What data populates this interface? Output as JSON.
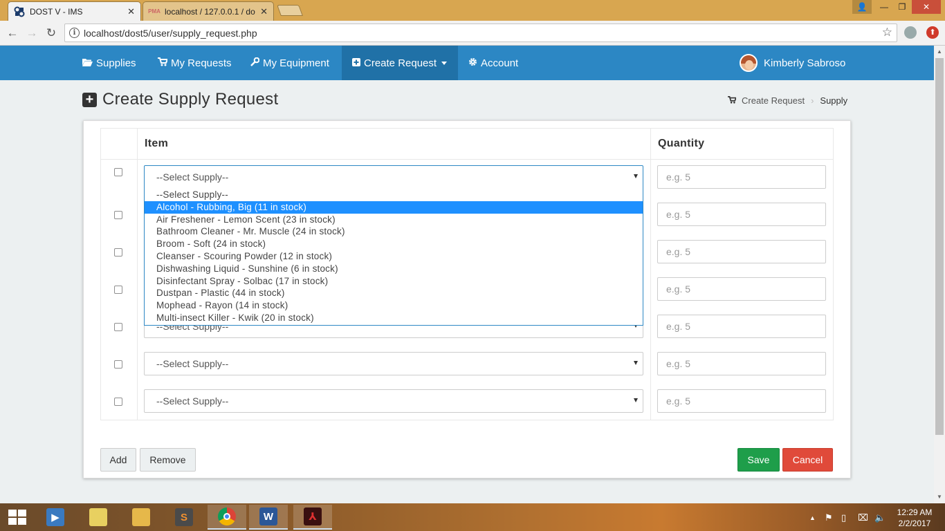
{
  "browser": {
    "tabs": [
      {
        "title": "DOST V - IMS",
        "active": true
      },
      {
        "title": "localhost / 127.0.0.1 / do",
        "active": false
      }
    ],
    "url": "localhost/dost5/user/supply_request.php"
  },
  "nav": {
    "items": [
      {
        "label": "Supplies",
        "icon": "folder-open-icon"
      },
      {
        "label": "My Requests",
        "icon": "cart-icon"
      },
      {
        "label": "My Equipment",
        "icon": "wrench-icon"
      },
      {
        "label": "Create Request",
        "icon": "plus-square-icon",
        "active": true,
        "dropdown": true
      },
      {
        "label": "Account",
        "icon": "gear-icon"
      }
    ],
    "user_name": "Kimberly Sabroso"
  },
  "page": {
    "title": "Create Supply Request",
    "breadcrumb": [
      "Create Request",
      "Supply"
    ]
  },
  "table": {
    "headers": {
      "item": "Item",
      "quantity": "Quantity"
    },
    "select_placeholder": "--Select Supply--",
    "qty_placeholder": "e.g. 5",
    "rows": 7,
    "dropdown_options": [
      "--Select Supply--",
      "Alcohol - Rubbing, Big (11 in stock)",
      "Air Freshener - Lemon Scent (23 in stock)",
      "Bathroom Cleaner - Mr. Muscle (24 in stock)",
      "Broom - Soft (24 in stock)",
      "Cleanser - Scouring Powder (12 in stock)",
      "Dishwashing Liquid - Sunshine (6 in stock)",
      "Disinfectant Spray - Solbac (17 in stock)",
      "Dustpan - Plastic (44 in stock)",
      "Mophead - Rayon (14 in stock)",
      "Multi-insect Killer - Kwik (20 in stock)"
    ],
    "highlighted_option": "Alcohol - Rubbing, Big (11 in stock)"
  },
  "buttons": {
    "add": "Add",
    "remove": "Remove",
    "save": "Save",
    "cancel": "Cancel"
  },
  "colors": {
    "navbar": "#2c87c4",
    "save": "#1e9e4a",
    "cancel": "#e04a3a",
    "highlight": "#1e90ff"
  },
  "taskbar": {
    "time": "12:29 AM",
    "date": "2/2/2017"
  }
}
